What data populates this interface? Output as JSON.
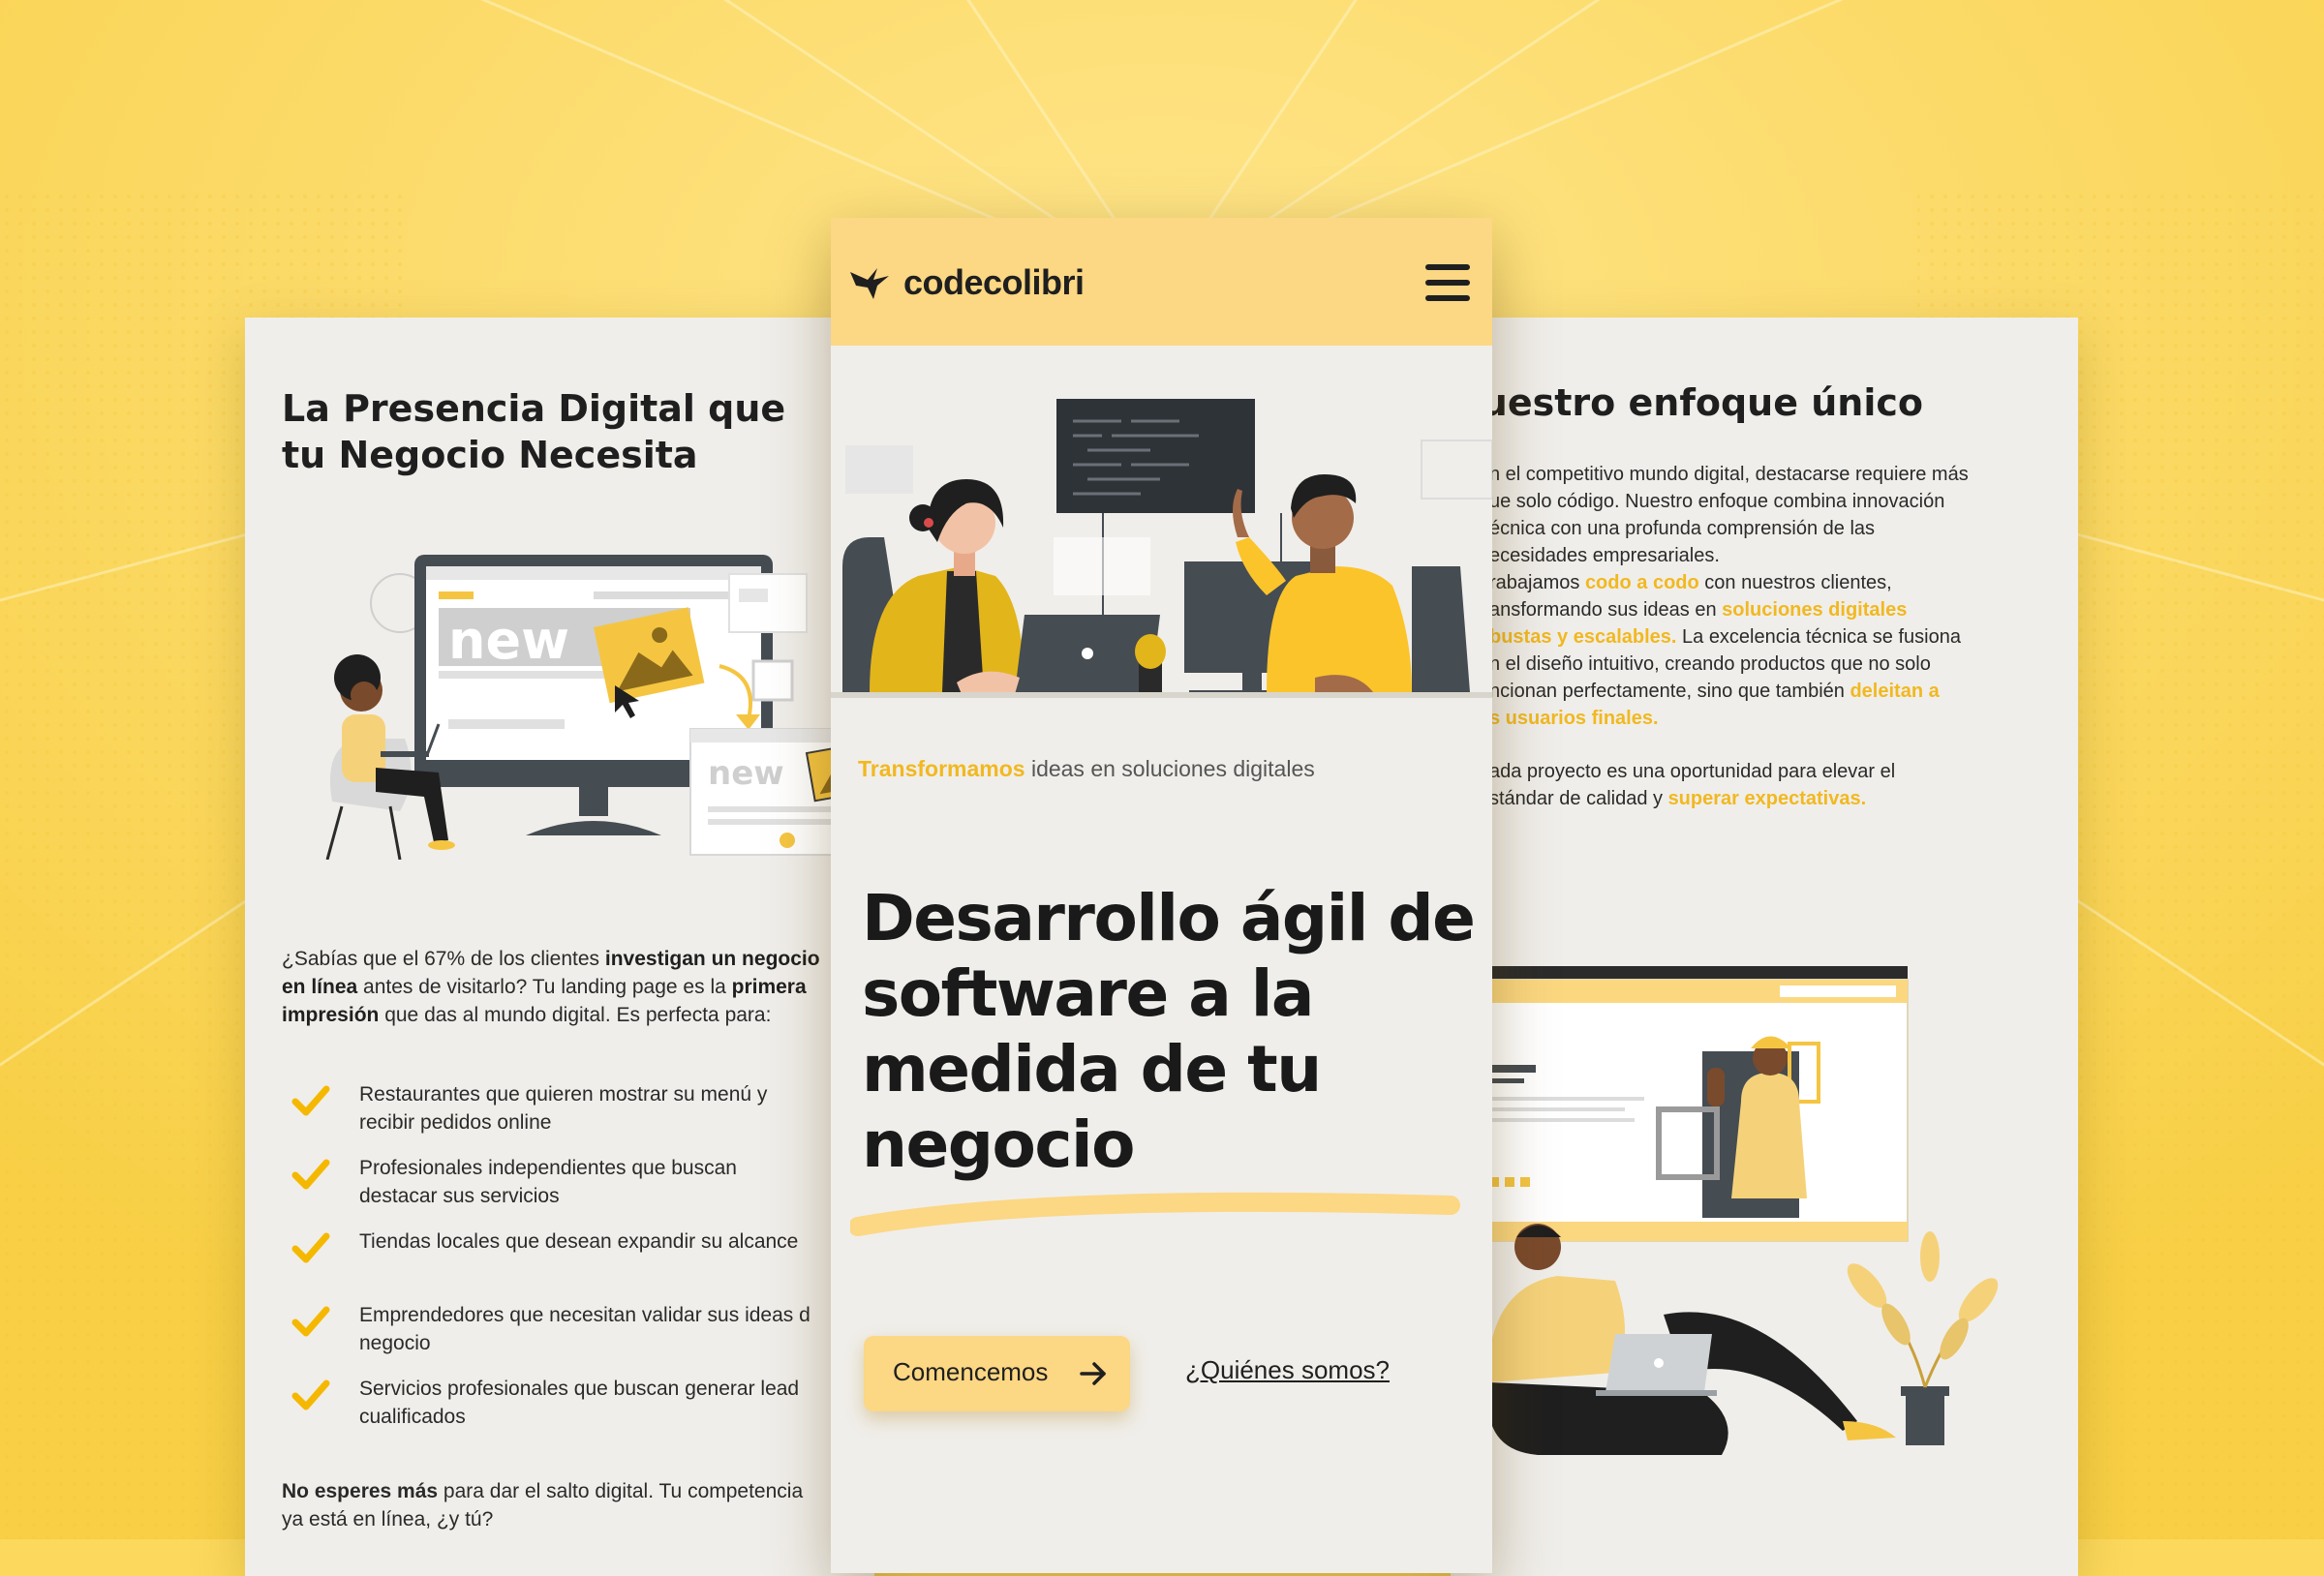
{
  "left_card": {
    "title": "La Presencia Digital que tu Negocio Necesita",
    "illustration_labels": [
      "new",
      "new"
    ],
    "intro": [
      {
        "text": "¿Sabías que el 67% de los clientes ",
        "bold": false
      },
      {
        "text": "investigan un negocio en línea",
        "bold": true
      },
      {
        "text": " antes de visitarlo? Tu landing page es la ",
        "bold": false
      },
      {
        "text": "primera impresión",
        "bold": true
      },
      {
        "text": " que das al mundo digital. Es perfecta para:",
        "bold": false
      }
    ],
    "list": [
      {
        "lines": [
          "Restaurantes que quieren mostrar su menú y",
          "recibir pedidos online"
        ]
      },
      {
        "lines": [
          "Profesionales independientes que buscan",
          "destacar sus servicios"
        ]
      },
      {
        "lines": [
          "Tiendas locales que desean expandir su alcance"
        ]
      },
      {
        "lines": [
          "Emprendedores que necesitan validar sus ideas d",
          "negocio"
        ]
      },
      {
        "lines": [
          "Servicios profesionales que buscan generar lead",
          "cualificados"
        ]
      }
    ],
    "outro_bold": "No esperes más",
    "outro_line1": " para dar el salto digital. Tu competencia",
    "outro_line2": "ya está en línea, ¿y tú?"
  },
  "center_card": {
    "brand": "codecolibri",
    "logo_icon": "hummingbird-icon",
    "menu_icon": "hamburger-menu-icon",
    "tagline_accent": "Transformamos",
    "tagline_rest": " ideas en soluciones digitales",
    "headline": "Desarrollo ágil de software a la medida de tu negocio",
    "cta_label": "Comencemos",
    "cta_icon": "arrow-right-icon",
    "secondary_link": "¿Quiénes somos?"
  },
  "right_card": {
    "title": "Nuestro enfoque único",
    "paragraphs": [
      [
        {
          "t": "n el competitivo mundo digital, destacarse requiere más",
          "hl": false,
          "br": true
        },
        {
          "t": "ue solo código. Nuestro enfoque combina innovación",
          "hl": false,
          "br": true
        },
        {
          "t": "écnica con una profunda comprensión de las",
          "hl": false,
          "br": true
        },
        {
          "t": "ecesidades empresariales.",
          "hl": false,
          "br": false
        }
      ],
      [
        {
          "t": "rabajamos ",
          "hl": false,
          "br": false
        },
        {
          "t": "codo a codo",
          "hl": true,
          "br": false
        },
        {
          "t": " con nuestros clientes,",
          "hl": false,
          "br": true
        },
        {
          "t": "ansformando sus ideas en ",
          "hl": false,
          "br": false
        },
        {
          "t": "soluciones digitales",
          "hl": true,
          "br": true
        },
        {
          "t": "bustas y escalables.",
          "hl": true,
          "br": false
        },
        {
          "t": " La excelencia técnica se fusiona",
          "hl": false,
          "br": true
        },
        {
          "t": "n el diseño intuitivo, creando productos que no solo",
          "hl": false,
          "br": true
        },
        {
          "t": "ncionan perfectamente, sino que también ",
          "hl": false,
          "br": false
        },
        {
          "t": "deleitan a",
          "hl": true,
          "br": true
        },
        {
          "t": "s usuarios finales.",
          "hl": true,
          "br": false
        }
      ],
      [
        {
          "t": "ada proyecto es una oportunidad para elevar el",
          "hl": false,
          "br": true
        },
        {
          "t": "stándar de calidad y ",
          "hl": false,
          "br": false
        },
        {
          "t": "superar expectativas.",
          "hl": true,
          "br": false
        }
      ]
    ]
  },
  "colors": {
    "background": "#fcd95c",
    "accent": "#f1b820",
    "navbar": "#fcd784",
    "card": "#f0eeea",
    "dark": "#1f1f1f"
  }
}
